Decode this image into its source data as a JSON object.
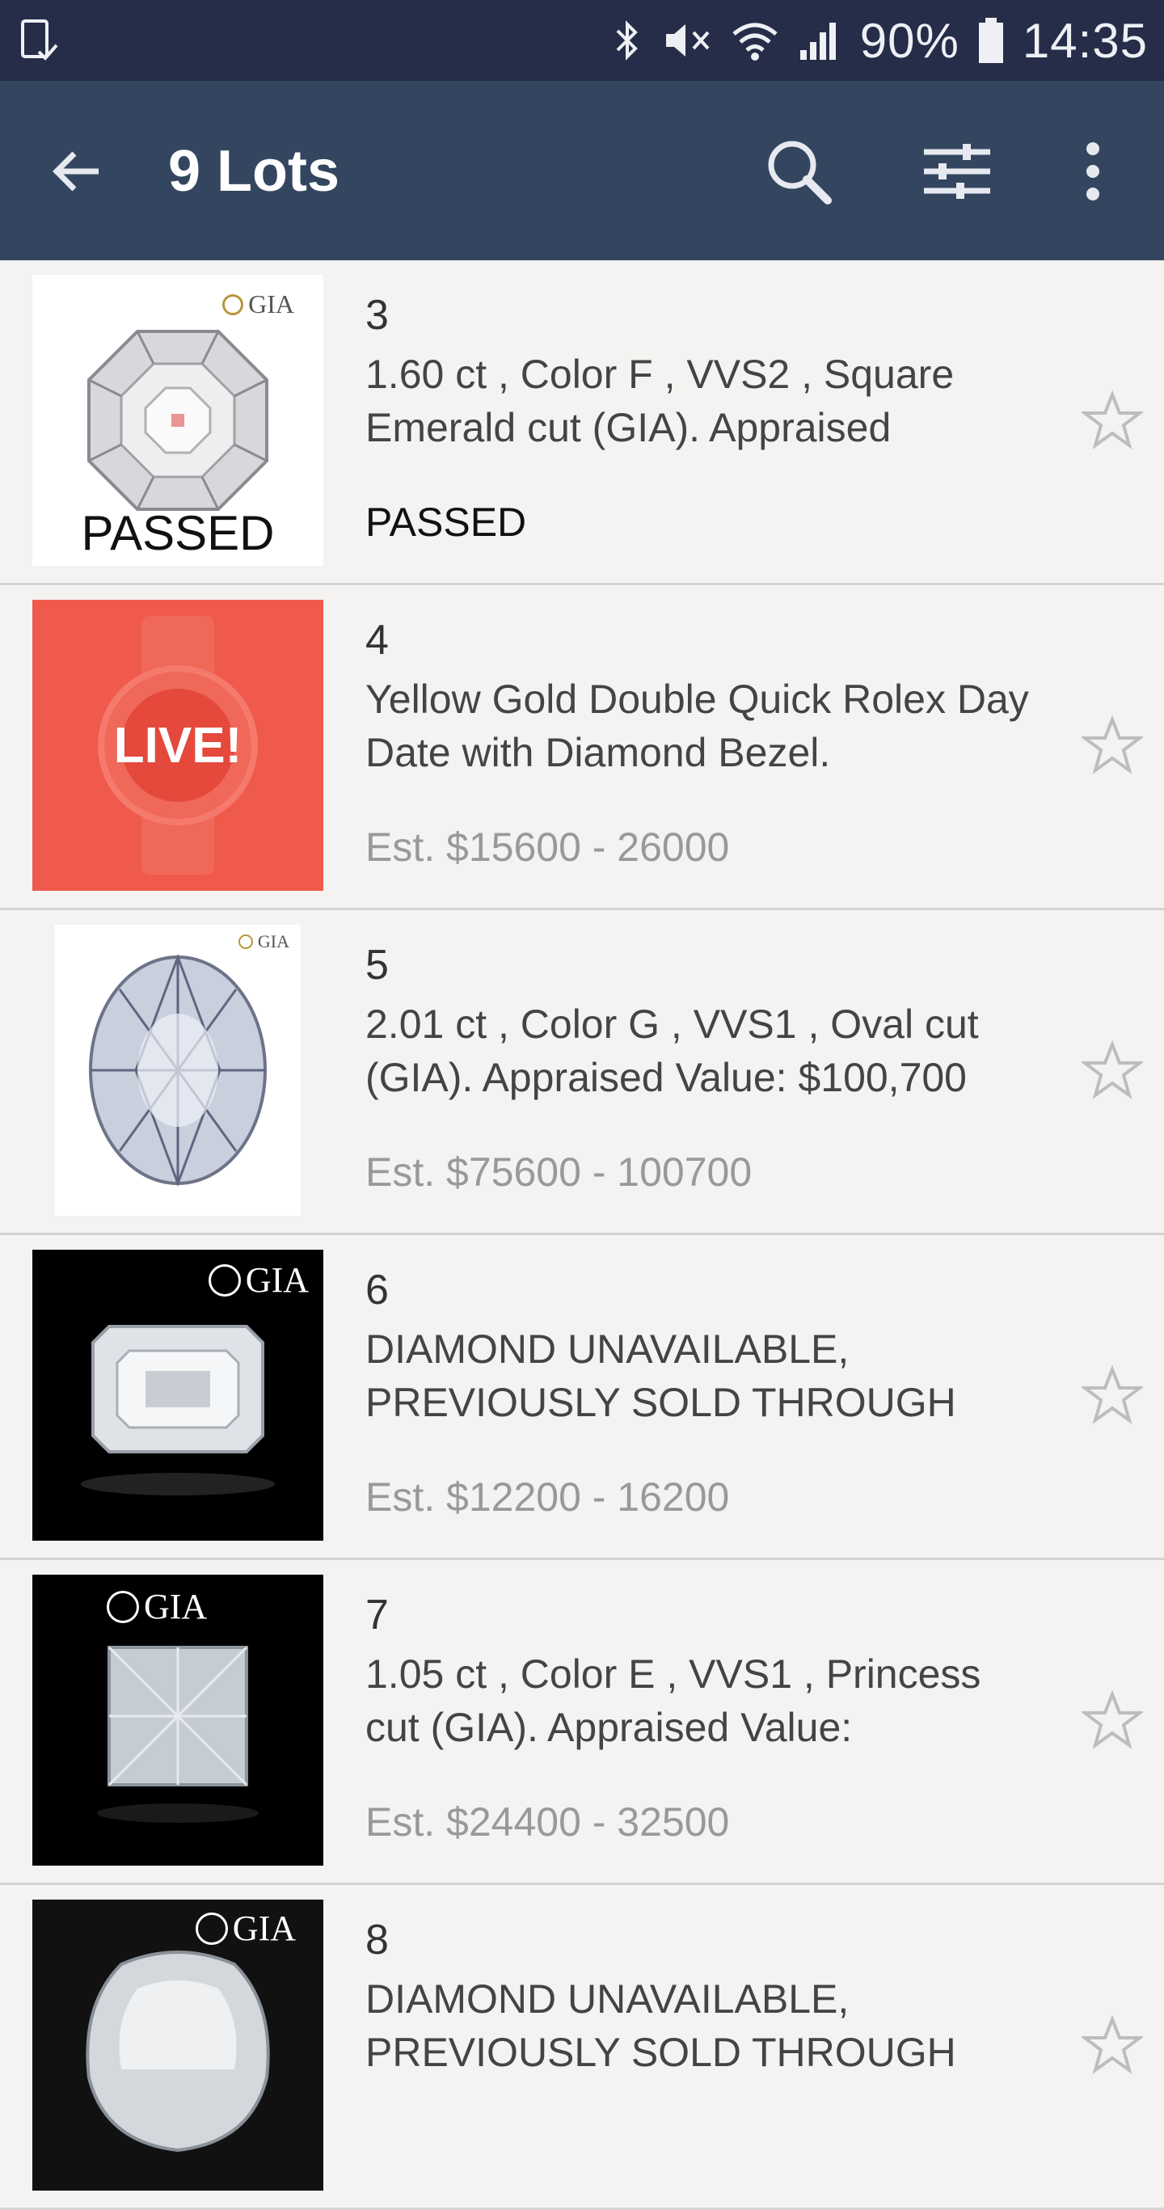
{
  "status_bar": {
    "battery": "90%",
    "time": "14:35",
    "icons": [
      "screenshot-icon",
      "bluetooth-icon",
      "mute-icon",
      "wifi-icon",
      "signal-icon",
      "battery-icon"
    ]
  },
  "app_bar": {
    "title": "9 Lots",
    "actions": [
      "search-icon",
      "filter-icon",
      "more-icon"
    ],
    "background": "#34465f"
  },
  "lots": [
    {
      "number": "3",
      "description": "1.60 ct , Color F , VVS2 , Square Emerald cut (GIA). Appraised",
      "status": "PASSED",
      "thumb_overlay": "PASSED",
      "thumb_logo": "GIA"
    },
    {
      "number": "4",
      "description": "Yellow Gold Double Quick Rolex Day Date with Diamond Bezel.",
      "status": "Est. $15600 - 26000",
      "thumb_badge": "LIVE!"
    },
    {
      "number": "5",
      "description": "2.01 ct , Color G , VVS1 , Oval cut (GIA). Appraised Value: $100,700",
      "status": "Est. $75600 - 100700",
      "thumb_logo": "GIA"
    },
    {
      "number": "6",
      "description": "DIAMOND UNAVAILABLE, PREVIOUSLY SOLD THROUGH",
      "status": "Est. $12200 - 16200",
      "thumb_logo": "GIA"
    },
    {
      "number": "7",
      "description": "1.05 ct , Color E , VVS1 , Princess cut (GIA). Appraised Value:",
      "status": "Est. $24400 - 32500",
      "thumb_logo": "GIA"
    },
    {
      "number": "8",
      "description": "DIAMOND UNAVAILABLE, PREVIOUSLY SOLD THROUGH",
      "status": "",
      "thumb_logo": "GIA"
    }
  ],
  "colors": {
    "status_bar": "#262d48",
    "app_bar": "#34465f",
    "live_badge": "#ef5a4c",
    "estimate_text": "#999999"
  }
}
